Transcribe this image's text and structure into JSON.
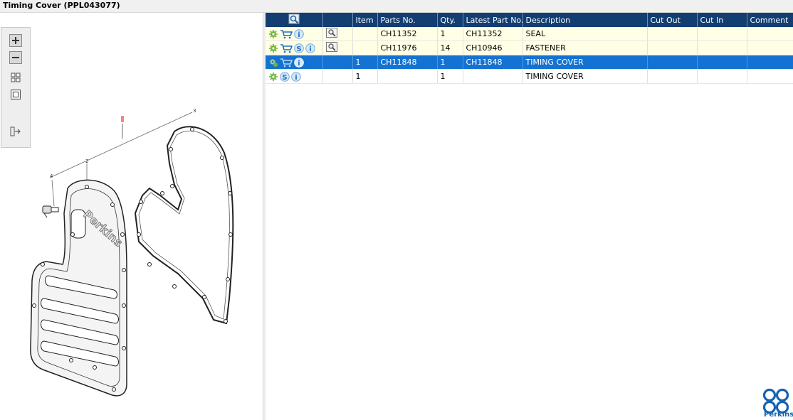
{
  "window": {
    "title": "Timing Cover (PPL043077)"
  },
  "diagram": {
    "brand_text": "Perkins",
    "callouts": [
      "2",
      "3",
      "4"
    ]
  },
  "toolbar": {
    "zoom_in": "zoom-in",
    "zoom_out": "zoom-out",
    "fit_all": "fit-all",
    "fit_window": "fit-window",
    "toggle_list": "toggle-list"
  },
  "grid": {
    "columns": [
      "",
      "",
      "Item",
      "Parts No.",
      "Qty.",
      "Latest Part No.",
      "Description",
      "Cut Out",
      "Cut In",
      "Comment"
    ],
    "rows": [
      {
        "item": "",
        "parts_no": "CH11352",
        "qty": "1",
        "latest": "CH11352",
        "description": "SEAL",
        "cut_out": "",
        "cut_in": "",
        "comment": ""
      },
      {
        "item": "",
        "parts_no": "CH11976",
        "qty": "14",
        "latest": "CH10946",
        "description": "FASTENER",
        "cut_out": "",
        "cut_in": "",
        "comment": ""
      },
      {
        "item": "1",
        "parts_no": "CH11848",
        "qty": "1",
        "latest": "CH11848",
        "description": "TIMING COVER",
        "cut_out": "",
        "cut_in": "",
        "comment": ""
      },
      {
        "item": "1",
        "parts_no": "",
        "qty": "1",
        "latest": "",
        "description": "TIMING COVER",
        "cut_out": "",
        "cut_in": "",
        "comment": ""
      }
    ]
  },
  "logo": {
    "text": "Perkins",
    "color": "#1463b0"
  },
  "colors": {
    "header": "#123e72",
    "selected": "#1473d2",
    "highlight_row": "#ffffe6"
  }
}
